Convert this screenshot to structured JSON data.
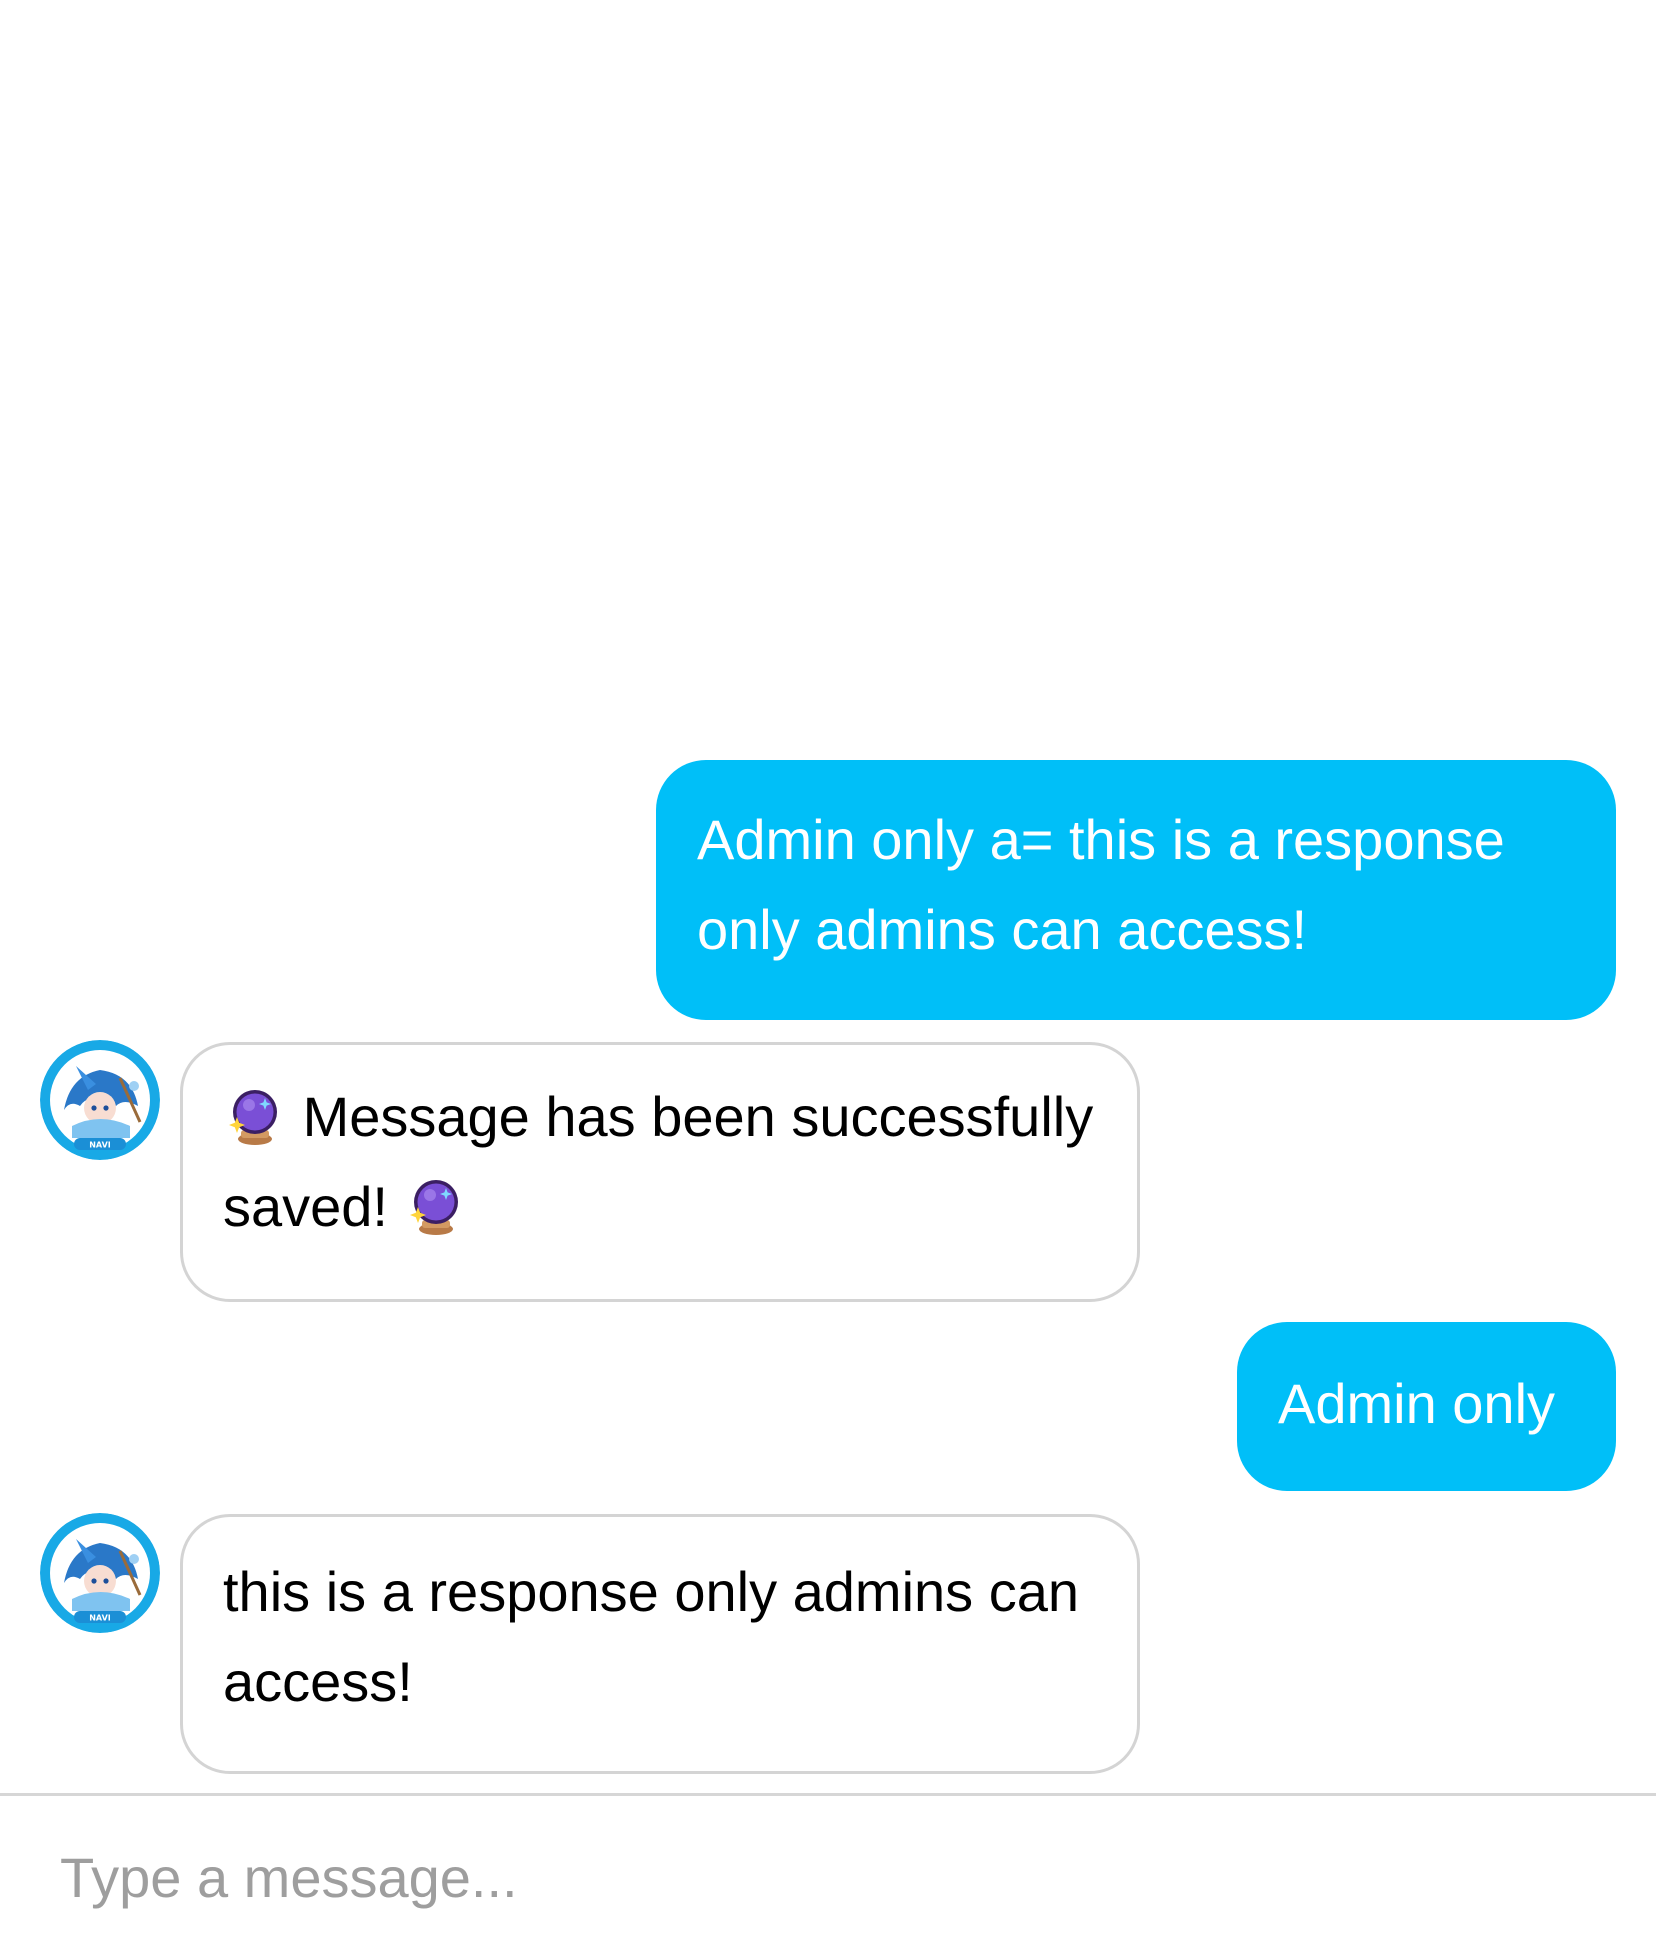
{
  "messages": [
    {
      "direction": "outgoing",
      "text": "Admin only a= this is a response only admins can access!"
    },
    {
      "direction": "incoming",
      "avatar_label": "NAVI",
      "prefix_icon": "crystal-ball-icon",
      "text": "Message has been successfully saved!",
      "suffix_icon": "crystal-ball-icon"
    },
    {
      "direction": "outgoing",
      "text": "Admin only"
    },
    {
      "direction": "incoming",
      "avatar_label": "NAVI",
      "text": "this is a response only admins can access!"
    }
  ],
  "composer": {
    "placeholder": "Type a message..."
  },
  "colors": {
    "outgoing_bubble": "#00bff8",
    "incoming_border": "#d4d4d4",
    "avatar_ring": "#18a9e6",
    "orb_purple": "#7a4fd6",
    "orb_stand": "#c98a52"
  }
}
